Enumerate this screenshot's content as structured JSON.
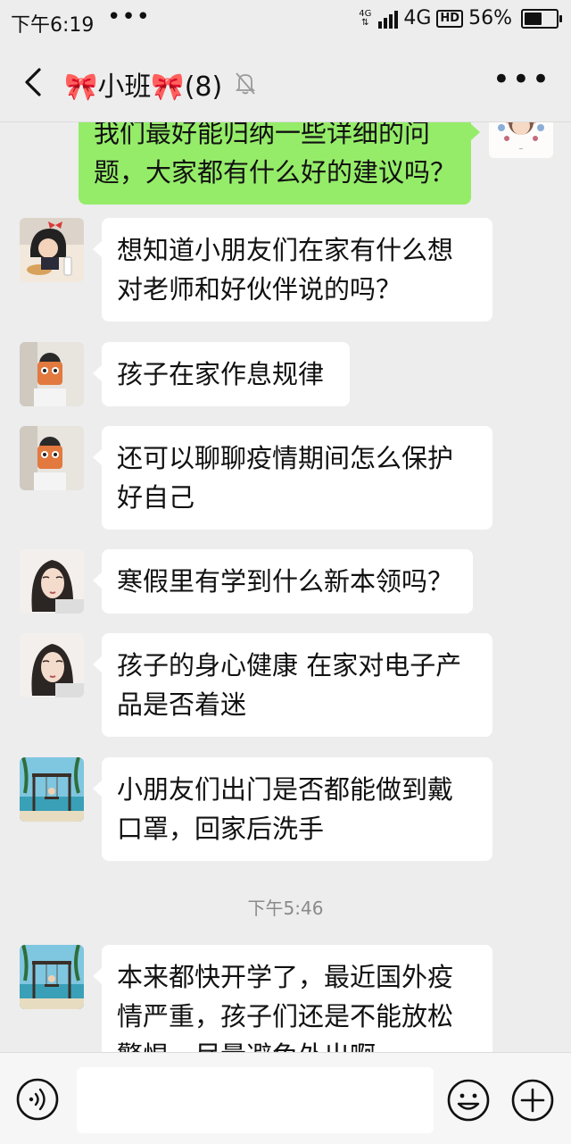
{
  "status": {
    "time": "下午6:19",
    "dots": "•••",
    "network_small": "4G",
    "network": "4G",
    "hd": "HD",
    "battery_text": "56%",
    "battery_level": 0.56
  },
  "header": {
    "title": "🎀小班🎀(8)",
    "more_label": "•••"
  },
  "messages": [
    {
      "from": "me",
      "text_lines": [
        "我们最好能归纳一些详细的问",
        "题，大家都有什么好的建议吗？"
      ]
    },
    {
      "from": "other",
      "text_lines": [
        "想知道小朋友们在家有什么想",
        "对老师和好伙伴说的吗？"
      ]
    },
    {
      "from": "other",
      "text_lines": [
        "孩子在家作息规律"
      ]
    },
    {
      "from": "other",
      "text_lines": [
        "还可以聊聊疫情期间怎么保护",
        "好自己"
      ]
    },
    {
      "from": "other",
      "text_lines": [
        "寒假里有学到什么新本领吗？"
      ]
    },
    {
      "from": "other",
      "text_lines": [
        "孩子的身心健康 在家对电子产",
        "品是否着迷"
      ]
    },
    {
      "from": "other",
      "text_lines": [
        "小朋友们出门是否都能做到戴",
        "口罩，回家后洗手"
      ]
    },
    {
      "from": "system",
      "text": "下午5:46"
    },
    {
      "from": "other",
      "text_lines": [
        "本来都快开学了，最近国外疫",
        "情严重，孩子们还是不能放松",
        "警惕，尽量避免外出啊"
      ]
    }
  ],
  "input": {
    "value": "",
    "placeholder": ""
  }
}
